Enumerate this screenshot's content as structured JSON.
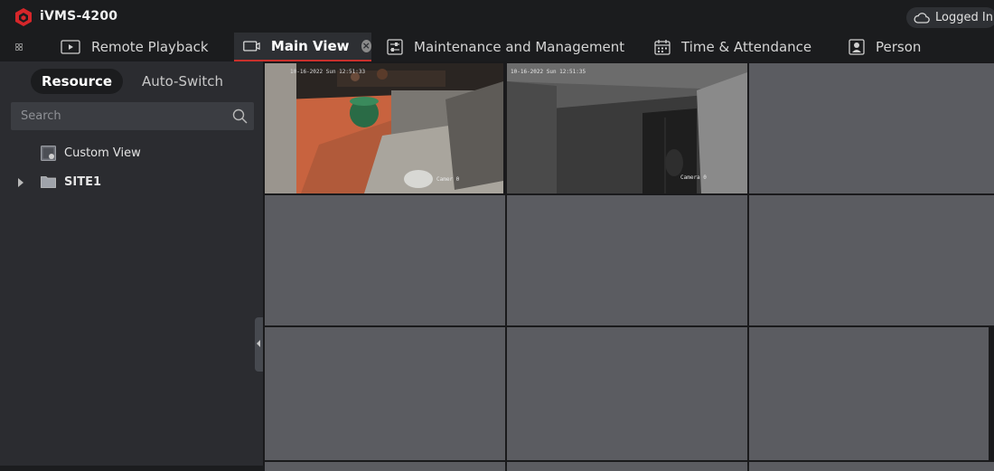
{
  "app": {
    "title": "iVMS-4200",
    "login_status": "Logged In"
  },
  "tabs": [
    {
      "label": "",
      "icon": "grid-menu-icon"
    },
    {
      "label": "Remote Playback",
      "icon": "playback-icon"
    },
    {
      "label": "Main View",
      "icon": "monitor-icon",
      "active": true,
      "closable": true
    },
    {
      "label": "Maintenance and Management",
      "icon": "settings-sliders-icon"
    },
    {
      "label": "Time & Attendance",
      "icon": "calendar-icon"
    },
    {
      "label": "Person",
      "icon": "person-card-icon"
    }
  ],
  "sidebar": {
    "segments": [
      {
        "label": "Resource",
        "active": true
      },
      {
        "label": "Auto-Switch",
        "active": false
      }
    ],
    "search": {
      "placeholder": "Search",
      "value": ""
    },
    "tree": [
      {
        "label": "Custom View",
        "icon": "custom-view-icon"
      },
      {
        "label": "SITE1",
        "icon": "folder-icon",
        "expandable": true
      }
    ]
  },
  "grid": {
    "layout": "3x3",
    "cells": [
      {
        "feed": "kitchen-camera",
        "overlay_text": "Camer 0"
      },
      {
        "feed": "corridor-camera",
        "overlay_text": "Camera 0"
      },
      {
        "feed": null
      },
      {
        "feed": null
      },
      {
        "feed": null
      },
      {
        "feed": null
      },
      {
        "feed": null
      },
      {
        "feed": null
      },
      {
        "feed": null
      }
    ]
  },
  "colors": {
    "accent": "#c9302c",
    "background": "#1b1c1e",
    "sidebar": "#2b2c30",
    "empty_cell": "#5b5c61"
  }
}
